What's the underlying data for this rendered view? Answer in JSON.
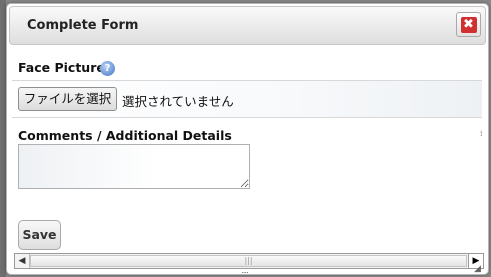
{
  "dialog": {
    "title": "Complete Form",
    "close_icon": "close-icon",
    "close_glyph": "✖"
  },
  "form": {
    "face_picture_label": "Face Picture",
    "help_icon": "help-icon",
    "help_glyph": "?",
    "file_button_label": "ファイルを選択",
    "file_status": "選択されていません",
    "comments_label": "Comments / Additional Details",
    "comments_value": "",
    "save_label": "Save"
  },
  "scrollbar": {
    "left_glyph": "◀",
    "right_glyph": "▶",
    "thumb_grip": "|||"
  },
  "grips": {
    "bottom": "::::",
    "right": "⁞",
    "corner": "◢"
  },
  "colors": {
    "close_red": "#d03030",
    "help_blue": "#3f74c5"
  }
}
